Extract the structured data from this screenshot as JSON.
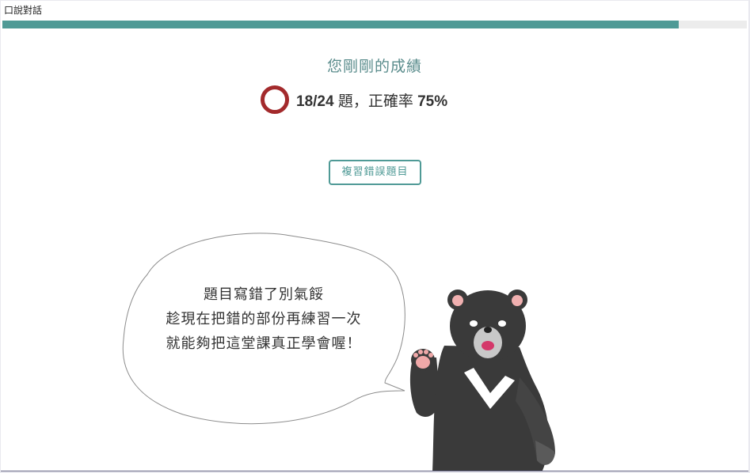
{
  "window": {
    "title": "口說對話"
  },
  "progress": {
    "fraction": 0.908,
    "track_color": "#ececec",
    "fill_color": "#4f9a96"
  },
  "result": {
    "heading": "您剛剛的成績",
    "score": "18/24",
    "score_suffix": " 題，正確率 ",
    "accuracy": "75%",
    "ring_color": "#a32a2c"
  },
  "actions": {
    "review_label": "複習錯誤題目"
  },
  "mascot": {
    "icon": "bear-mascot-icon",
    "speech": [
      "題目寫錯了別氣餒",
      "趁現在把錯的部份再練習一次",
      "就能夠把這堂課真正學會喔！"
    ]
  },
  "colors": {
    "accent": "#4f9a96",
    "heading": "#5a8c8c",
    "text": "#333333"
  }
}
